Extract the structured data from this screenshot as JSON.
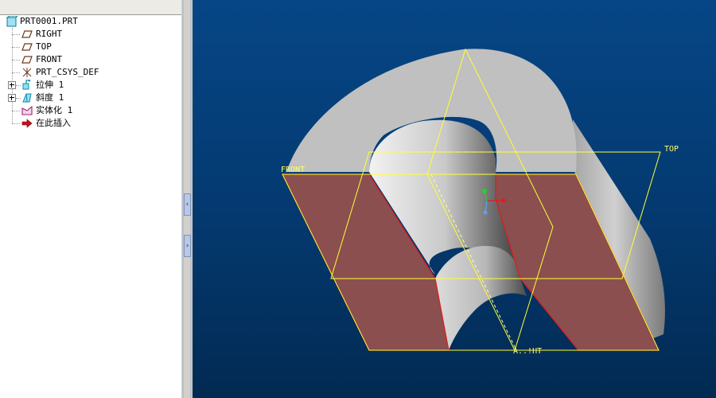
{
  "tree": {
    "root": {
      "label": "PRT0001.PRT",
      "icon": "part-icon"
    },
    "items": [
      {
        "label": "RIGHT",
        "icon": "datum-plane-icon"
      },
      {
        "label": "TOP",
        "icon": "datum-plane-icon"
      },
      {
        "label": "FRONT",
        "icon": "datum-plane-icon"
      },
      {
        "label": "PRT_CSYS_DEF",
        "icon": "coordinate-system-icon"
      },
      {
        "label": "拉伸 1",
        "icon": "extrude-icon",
        "expandable": true
      },
      {
        "label": "斜度 1",
        "icon": "draft-icon",
        "expandable": true
      },
      {
        "label": "实体化 1",
        "icon": "solidify-icon"
      },
      {
        "label": "在此插入",
        "icon": "insert-here-arrow-icon"
      }
    ]
  },
  "splitter": {
    "collapse_glyph": "‹",
    "expand_glyph": "›"
  },
  "viewport": {
    "plane_labels": {
      "front": "FRONT",
      "top": "TOP",
      "right": "A..!HT"
    },
    "colors": {
      "background_top": "#064686",
      "background_bottom": "#022a52",
      "datum": "#ffff33",
      "section_face": "#8b4f4f",
      "section_edge": "#e01c1c",
      "model_gray": "#c0c0c0"
    }
  }
}
